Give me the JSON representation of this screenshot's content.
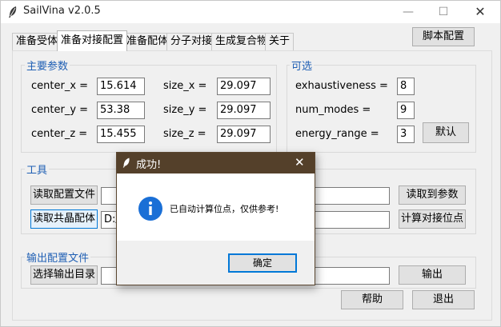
{
  "window": {
    "title": "SailVina v2.0.5",
    "min": "—",
    "max": "☐",
    "close": "✕"
  },
  "tabs": [
    "准备受体",
    "准备对接配置",
    "准备配体",
    "分子对接",
    "生成复合物",
    "关于"
  ],
  "script_config_button": "脚本配置",
  "main_params": {
    "title": "主要参数",
    "center_x": {
      "label": "center_x =",
      "value": "15.614"
    },
    "center_y": {
      "label": "center_y =",
      "value": "53.38"
    },
    "center_z": {
      "label": "center_z =",
      "value": "15.455"
    },
    "size_x": {
      "label": "size_x =",
      "value": "29.097"
    },
    "size_y": {
      "label": "size_y =",
      "value": "29.097"
    },
    "size_z": {
      "label": "size_z =",
      "value": "29.097"
    }
  },
  "optional": {
    "title": "可选",
    "exhaustiveness": {
      "label": "exhaustiveness =",
      "value": "8"
    },
    "num_modes": {
      "label": "num_modes =",
      "value": "9"
    },
    "energy_range": {
      "label": "energy_range =",
      "value": "3"
    },
    "default_button": "默认"
  },
  "tools": {
    "title": "工具",
    "read_config_button": "读取配置文件",
    "read_ligand_button": "读取共晶配体",
    "ligand_path_prefix": "D:/",
    "read_to_params_button": "读取到参数",
    "calc_site_button": "计算对接位点"
  },
  "output": {
    "title": "输出配置文件",
    "select_dir_button": "选择输出目录",
    "output_button": "输出"
  },
  "bottom": {
    "help_button": "帮助",
    "exit_button": "退出"
  },
  "dialog": {
    "title": "成功!",
    "close": "✕",
    "message": "已自动计算位点，仅供参考!",
    "ok_button": "确定",
    "info_icon_glyph": "i"
  }
}
